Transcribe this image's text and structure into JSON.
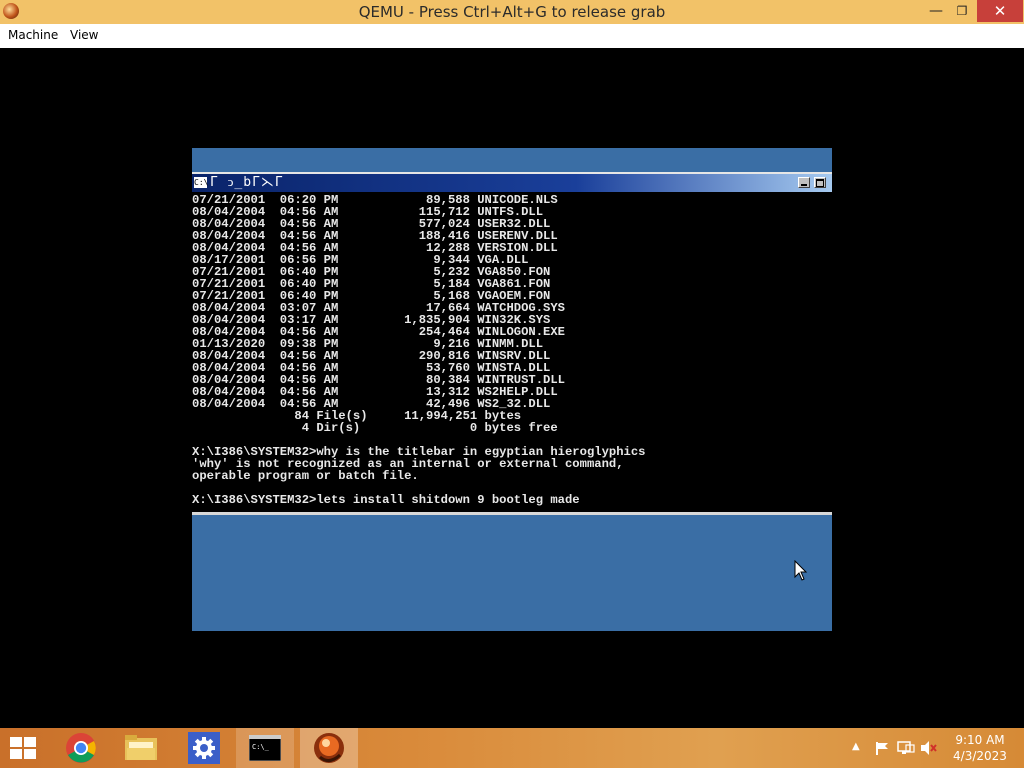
{
  "host_window": {
    "title": "QEMU - Press Ctrl+Alt+G to release grab",
    "minimize": "—",
    "maximize": "❐",
    "close": "✕",
    "menu": [
      "Machine",
      "View"
    ]
  },
  "console": {
    "system_icon": "C:\\",
    "title_glyphs": "Г ↄ_bГ⋋Г",
    "lines": [
      "07/21/2001  06:20 PM            89,588 UNICODE.NLS",
      "08/04/2004  04:56 AM           115,712 UNTFS.DLL",
      "08/04/2004  04:56 AM           577,024 USER32.DLL",
      "08/04/2004  04:56 AM           188,416 USERENV.DLL",
      "08/04/2004  04:56 AM            12,288 VERSION.DLL",
      "08/17/2001  06:56 PM             9,344 VGA.DLL",
      "07/21/2001  06:40 PM             5,232 VGA850.FON",
      "07/21/2001  06:40 PM             5,184 VGA861.FON",
      "07/21/2001  06:40 PM             5,168 VGAOEM.FON",
      "08/04/2004  03:07 AM            17,664 WATCHDOG.SYS",
      "08/04/2004  03:17 AM         1,835,904 WIN32K.SYS",
      "08/04/2004  04:56 AM           254,464 WINLOGON.EXE",
      "01/13/2020  09:38 PM             9,216 WINMM.DLL",
      "08/04/2004  04:56 AM           290,816 WINSRV.DLL",
      "08/04/2004  04:56 AM            53,760 WINSTA.DLL",
      "08/04/2004  04:56 AM            80,384 WINTRUST.DLL",
      "08/04/2004  04:56 AM            13,312 WS2HELP.DLL",
      "08/04/2004  04:56 AM            42,496 WS2_32.DLL",
      "              84 File(s)     11,994,251 bytes",
      "               4 Dir(s)               0 bytes free",
      "",
      "X:\\I386\\SYSTEM32>why is the titlebar in egyptian hieroglyphics",
      "'why' is not recognized as an internal or external command,",
      "operable program or batch file.",
      "",
      "X:\\I386\\SYSTEM32>lets install shitdown 9 bootleg made"
    ]
  },
  "taskbar": {
    "items": [
      "start-button",
      "chrome",
      "file-explorer",
      "settings",
      "command-prompt",
      "qemu"
    ],
    "clock_time": "9:10 AM",
    "clock_date": "4/3/2023",
    "tray_chevron": "▲"
  }
}
